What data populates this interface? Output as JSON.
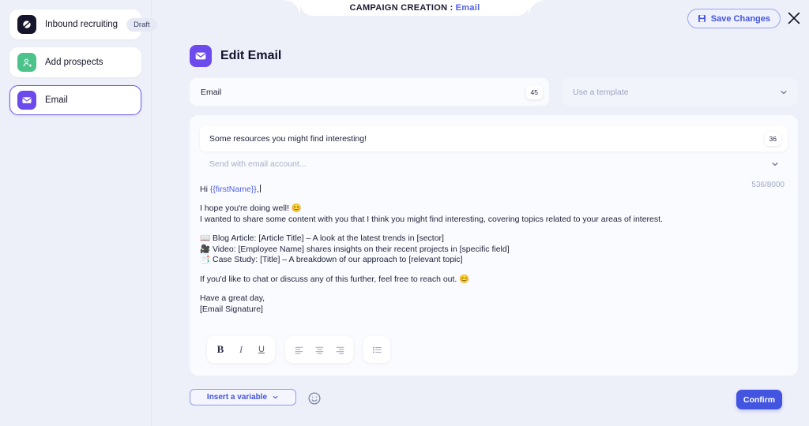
{
  "header": {
    "breadcrumb_prefix": "CAMPAIGN CREATION :",
    "breadcrumb_current": "Email",
    "save_label": "Save Changes",
    "save_icon": "floppy-disk-icon",
    "close_icon": "close-icon"
  },
  "sidebar": {
    "items": [
      {
        "label": "Inbound recruiting",
        "icon": "campaign-icon",
        "badge": "Draft",
        "selected": false
      },
      {
        "label": "Add prospects",
        "icon": "add-person-icon",
        "badge": "",
        "selected": false
      },
      {
        "label": "Email",
        "icon": "envelope-icon",
        "badge": "",
        "selected": true
      }
    ]
  },
  "main": {
    "page_title": "Edit Email",
    "page_icon": "envelope-icon",
    "email_field": {
      "label": "Email",
      "counter": "45"
    },
    "template_select": {
      "placeholder": "Use a template",
      "icon": "chevron-down-icon"
    },
    "editor": {
      "subject": "Some resources you might find interesting!",
      "subject_counter": "36",
      "account_placeholder": "Send with email account...",
      "account_icon": "chevron-down-icon",
      "body_counter": "536/8000",
      "body": {
        "greeting_prefix": "Hi ",
        "greeting_variable": "{{firstName}}",
        "greeting_suffix": ",",
        "line_hope": "I hope you're doing well! 😊",
        "line_intro": "I wanted to share some content with you that I think you might find interesting, covering topics related to your areas of interest.",
        "bullet_1": "📖 Blog Article: [Article Title] – A look at the latest trends in [sector]",
        "bullet_2": "🎥 Video: [Employee Name] shares insights on their recent projects in [specific field]",
        "bullet_3": "📑 Case Study: [Title] – A breakdown of our approach to [relevant topic]",
        "line_cta": "If you'd like to chat or discuss any of this further, feel free to reach out. 😊",
        "line_signoff": "Have a great day,",
        "line_signature": "[Email Signature]"
      }
    },
    "toolbar": {
      "bold": "B",
      "italic": "I",
      "underline": "U",
      "align_left_icon": "align-left-icon",
      "align_center_icon": "align-center-icon",
      "align_right_icon": "align-right-icon",
      "bullet_list_icon": "bullet-list-icon"
    },
    "footer": {
      "insert_variable_label": "Insert a variable",
      "insert_variable_icon": "chevron-down-icon",
      "emoji_icon": "smiley-icon",
      "confirm_label": "Confirm"
    }
  },
  "colors": {
    "background": "#eef0f9",
    "accent": "#4355e0",
    "purple": "#6d4aeb",
    "green": "#4cc38a",
    "dark": "#15162b"
  }
}
